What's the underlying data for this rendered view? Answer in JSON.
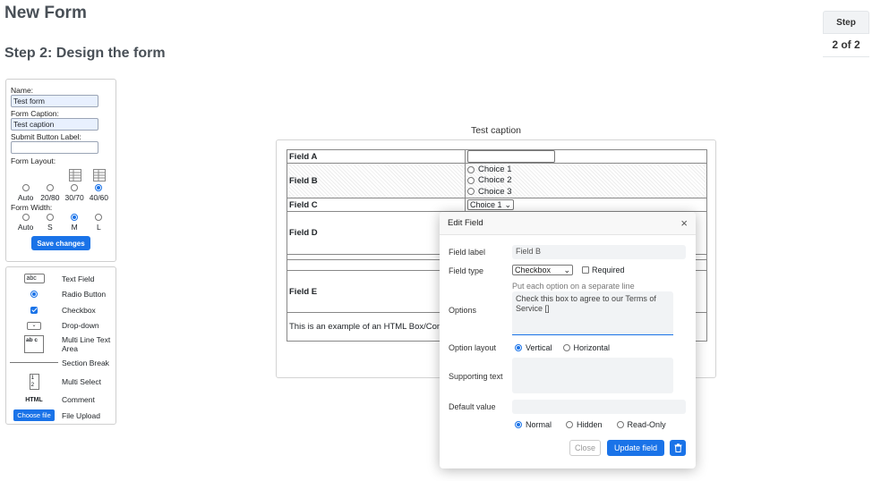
{
  "header": {
    "title": "New Form",
    "step_title": "Step 2: Design the form"
  },
  "step_indicator": {
    "label": "Step",
    "value": "2 of 2"
  },
  "settings": {
    "name_label": "Name:",
    "name_value": "Test form",
    "caption_label": "Form Caption:",
    "caption_value": "Test caption",
    "submit_label": "Submit Button Label:",
    "submit_value": "",
    "layout_label": "Form Layout:",
    "layout_options": [
      "Auto",
      "20/80",
      "30/70",
      "40/60"
    ],
    "layout_selected": "40/60",
    "width_label": "Form Width:",
    "width_options": [
      "Auto",
      "S",
      "M",
      "L"
    ],
    "width_selected": "M",
    "save_label": "Save changes"
  },
  "palette": {
    "items": [
      {
        "label": "Text Field",
        "icon": "text-field-icon",
        "sample": "abc"
      },
      {
        "label": "Radio Button",
        "icon": "radio-button-icon"
      },
      {
        "label": "Checkbox",
        "icon": "checkbox-icon"
      },
      {
        "label": "Drop-down",
        "icon": "dropdown-icon"
      },
      {
        "label": "Multi Line Text Area",
        "icon": "textarea-icon",
        "sample": "ab c"
      },
      {
        "label": "Section Break",
        "icon": "section-break-icon"
      },
      {
        "label": "Multi Select",
        "icon": "multi-select-icon",
        "sample": "1 2"
      },
      {
        "label": "Comment",
        "icon": "html-icon",
        "sample": "HTML"
      },
      {
        "label": "File Upload",
        "icon": "file-upload-icon",
        "sample": "Choose file"
      }
    ]
  },
  "preview": {
    "caption": "Test caption",
    "fields": {
      "a": "Field A",
      "b": "Field B",
      "b_choices": [
        "Choice 1",
        "Choice 2",
        "Choice 3"
      ],
      "c": "Field C",
      "c_value": "Choice 1",
      "d": "Field D",
      "e": "Field E",
      "html_text": "This is an example of an HTML Box/Com"
    }
  },
  "edit_field": {
    "title": "Edit Field",
    "field_label_label": "Field label",
    "field_label_value": "Field B",
    "field_type_label": "Field type",
    "field_type_value": "Checkbox",
    "required_label": "Required",
    "options_hint": "Put each option on a separate line",
    "options_label": "Options",
    "options_value": "Check this box to agree to our Terms of Service []",
    "layout_label": "Option layout",
    "layout_vertical": "Vertical",
    "layout_horizontal": "Horizontal",
    "supporting_label": "Supporting text",
    "default_label": "Default value",
    "visibility_options": [
      "Normal",
      "Hidden",
      "Read-Only"
    ],
    "visibility_selected": "Normal",
    "close_label": "Close",
    "update_label": "Update field",
    "accent": "#1a73e8"
  }
}
